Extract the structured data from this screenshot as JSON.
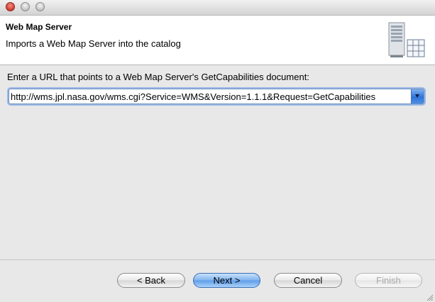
{
  "window": {
    "controls": [
      "close-button",
      "minimize-button",
      "zoom-button"
    ]
  },
  "header": {
    "title": "Web Map Server",
    "description": "Imports a Web Map Server into the catalog",
    "icon": "server-grid-icon"
  },
  "main": {
    "prompt": "Enter a URL that points to a Web Map Server's GetCapabilities document:",
    "url_value": "http://wms.jpl.nasa.gov/wms.cgi?Service=WMS&Version=1.1.1&Request=GetCapabilities"
  },
  "footer": {
    "back_label": "< Back",
    "next_label": "Next >",
    "cancel_label": "Cancel",
    "finish_label": "Finish",
    "finish_enabled": false
  },
  "colors": {
    "accent": "#5f9ce7",
    "focus_ring": "#9ab9e6",
    "header_bg": "#ffffff",
    "panel_bg": "#e8e8e8"
  }
}
